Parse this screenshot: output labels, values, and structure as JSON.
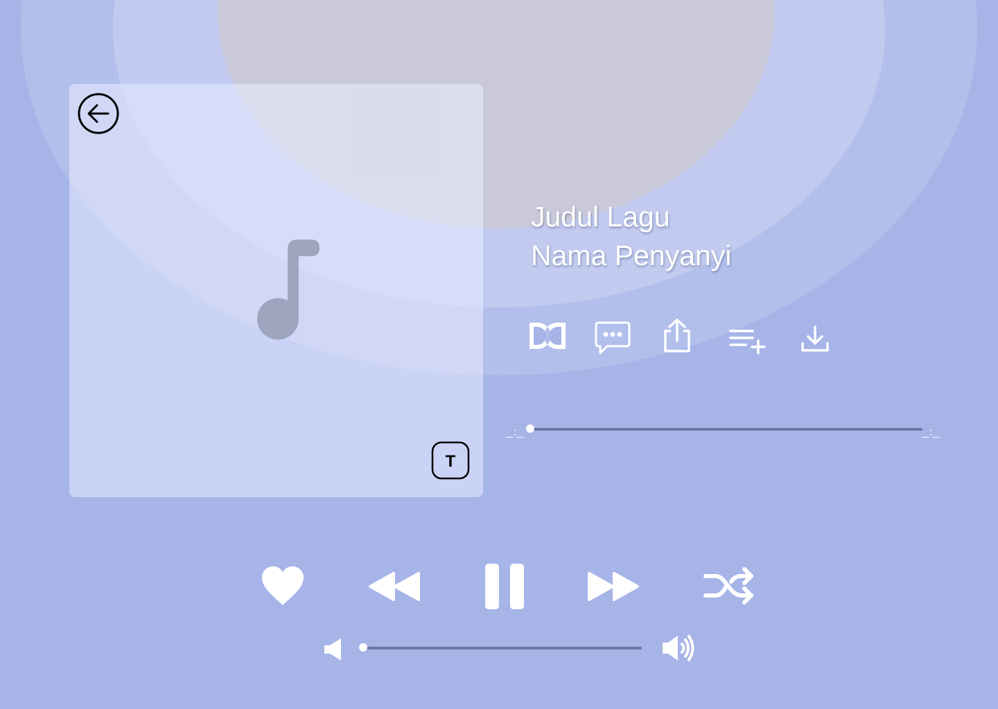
{
  "theme": {
    "background": "#a6b4e8",
    "icon_color": "#ffffff",
    "track_color": "#6b78a3"
  },
  "artwork": {
    "placeholder_icon": "music-note-icon",
    "back_icon": "back-arrow-icon",
    "text_toggle_label": "T"
  },
  "song": {
    "title": "Judul Lagu",
    "artist": "Nama Penyanyi"
  },
  "actions": [
    "dolby-icon",
    "lyrics-icon",
    "share-icon",
    "add-to-queue-icon",
    "download-icon"
  ],
  "progress": {
    "current": "_:_",
    "duration": "_:_",
    "fraction": 0
  },
  "controls": [
    "heart-icon",
    "previous-icon",
    "pause-icon",
    "next-icon",
    "shuffle-icon"
  ],
  "volume": {
    "level": 0,
    "low_icon": "volume-low-icon",
    "high_icon": "volume-high-icon"
  }
}
